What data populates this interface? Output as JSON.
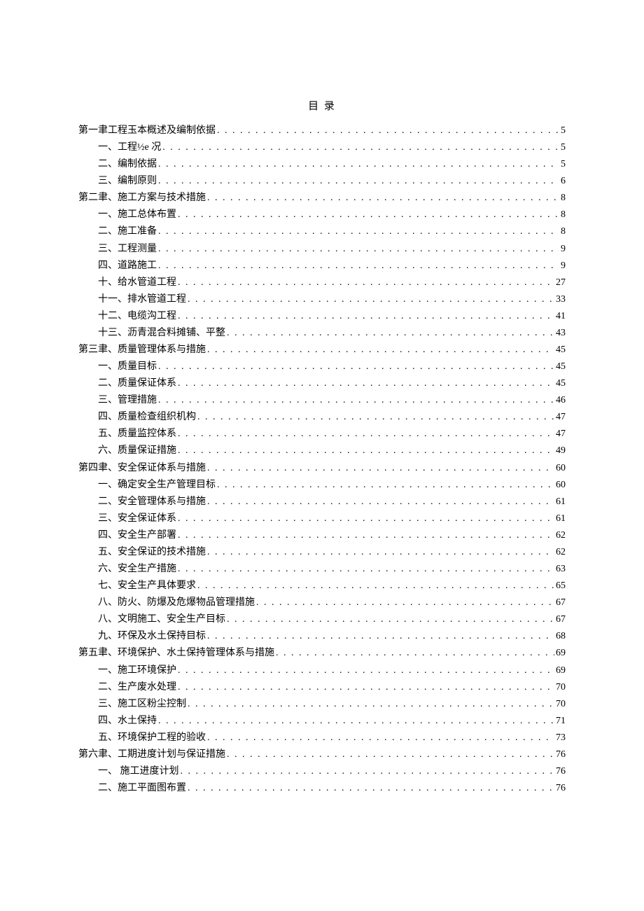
{
  "title": "目 录",
  "toc": [
    {
      "level": 0,
      "label": "第一聿工程玉本概述及编制依据",
      "page": "5"
    },
    {
      "level": 1,
      "label": "一、工程½e 况",
      "page": "5"
    },
    {
      "level": 1,
      "label": "二、编制依据",
      "page": "5"
    },
    {
      "level": 1,
      "label": "三、编制原则",
      "page": "6"
    },
    {
      "level": 0,
      "label": "第二聿、施工方案与技术措施",
      "page": "8"
    },
    {
      "level": 1,
      "label": "一、施工总体布置",
      "page": "8"
    },
    {
      "level": 1,
      "label": "二、施工准备",
      "page": "8"
    },
    {
      "level": 1,
      "label": "三、工程测量",
      "page": "9"
    },
    {
      "level": 1,
      "label": "四、道路施工",
      "page": "9"
    },
    {
      "level": 1,
      "label": "十、给水管道工程",
      "page": "27"
    },
    {
      "level": 1,
      "label": "十一、排水管道工程",
      "page": "33"
    },
    {
      "level": 1,
      "label": "十二、电缆沟工程",
      "page": "41"
    },
    {
      "level": 1,
      "label": "十三、沥青混合料摊铺、平整",
      "page": "43"
    },
    {
      "level": 0,
      "label": "第三聿、质量管理体系与措施",
      "page": "45"
    },
    {
      "level": 1,
      "label": "一、质量目标",
      "page": "45"
    },
    {
      "level": 1,
      "label": "二、质量保证体系",
      "page": "45"
    },
    {
      "level": 1,
      "label": "三、管理措施",
      "page": "46"
    },
    {
      "level": 1,
      "label": "四、质量检查组织机构",
      "page": "47"
    },
    {
      "level": 1,
      "label": "五、质量监控体系",
      "page": "47"
    },
    {
      "level": 1,
      "label": "六、质量保证措施",
      "page": "49"
    },
    {
      "level": 0,
      "label": "第四聿、安全保证体系与措施",
      "page": "60"
    },
    {
      "level": 1,
      "label": "一、确定安全生产管理目标",
      "page": "60"
    },
    {
      "level": 1,
      "label": "二、安全管理体系与措施",
      "page": "61"
    },
    {
      "level": 1,
      "label": "三、安全保证体系",
      "page": "61"
    },
    {
      "level": 1,
      "label": "四、安全生产部署",
      "page": "62"
    },
    {
      "level": 1,
      "label": "五、安全保证的技术措施",
      "page": "62"
    },
    {
      "level": 1,
      "label": "六、安全生产措施",
      "page": "63"
    },
    {
      "level": 1,
      "label": "七、安全生产具体要求",
      "page": "65"
    },
    {
      "level": 1,
      "label": "八、防火、防爆及危爆物品管理措施",
      "page": "67"
    },
    {
      "level": 1,
      "label": "八、文明施工、安全生产目标",
      "page": "67"
    },
    {
      "level": 1,
      "label": "九、环保及水土保持目标",
      "page": "68"
    },
    {
      "level": 0,
      "label": "第五聿、环境保护、水土保持管理体系与措施",
      "page": "69"
    },
    {
      "level": 1,
      "label": "一、施工环境保护",
      "page": "69"
    },
    {
      "level": 1,
      "label": "二、生产废水处理",
      "page": "70"
    },
    {
      "level": 1,
      "label": "三、施工区粉尘控制",
      "page": "70"
    },
    {
      "level": 1,
      "label": "四、水土保持",
      "page": "71"
    },
    {
      "level": 1,
      "label": "五、环境保护工程的验收",
      "page": "73"
    },
    {
      "level": 0,
      "label": "第六聿、工期进度计划与保证措施",
      "page": "76"
    },
    {
      "level": 1,
      "label": "一、 施工进度计划",
      "page": "76"
    },
    {
      "level": 1,
      "label": "二、施工平面图布置",
      "page": "76"
    }
  ]
}
